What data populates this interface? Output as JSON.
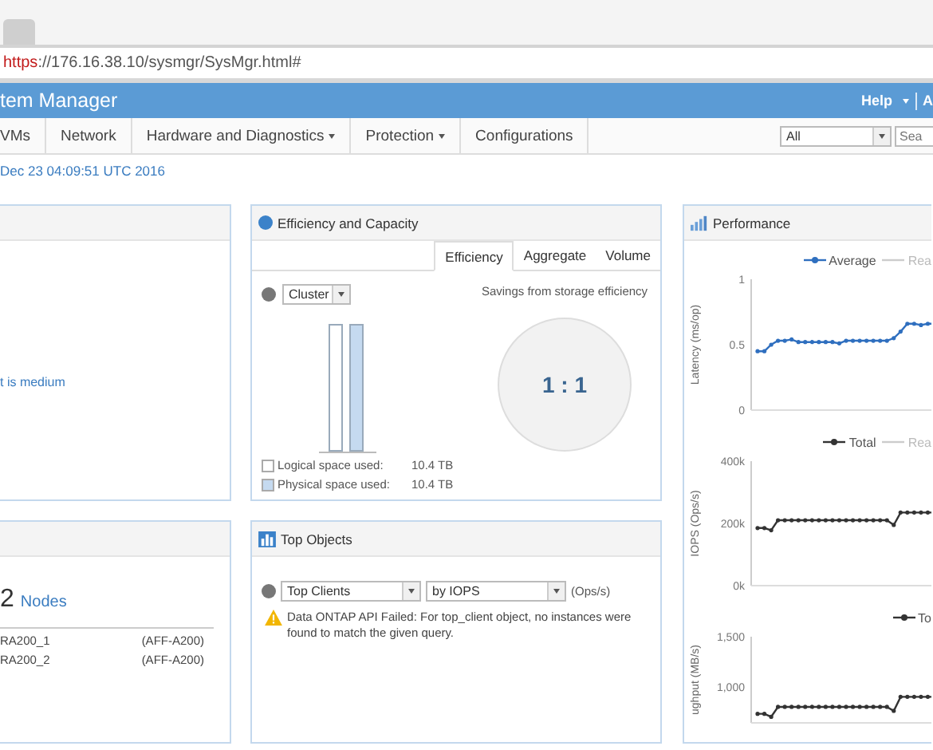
{
  "address_bar": {
    "scheme": "https",
    "rest": "://176.16.38.10/sysmgr/SysMgr.html#"
  },
  "header": {
    "title": "tem Manager",
    "menus": [
      {
        "label": "Help",
        "has_menu": true
      },
      {
        "label": "A",
        "has_menu": false
      }
    ]
  },
  "nav": {
    "items": [
      {
        "label": "VMs",
        "has_menu": false
      },
      {
        "label": "Network",
        "has_menu": false
      },
      {
        "label": "Hardware and Diagnostics",
        "has_menu": true
      },
      {
        "label": "Protection",
        "has_menu": true
      },
      {
        "label": "Configurations",
        "has_menu": false
      }
    ],
    "scope_select": {
      "value": "All"
    },
    "search": {
      "placeholder": "Sea"
    }
  },
  "last_updated": "Dec 23 04:09:51 UTC 2016",
  "health_panel": {
    "message": "t is medium"
  },
  "nodes_panel": {
    "count": "2",
    "label": "Nodes",
    "rows": [
      {
        "name": "RA200_1",
        "model": "(AFF-A200)"
      },
      {
        "name": "RA200_2",
        "model": "(AFF-A200)"
      }
    ]
  },
  "efficiency_panel": {
    "title": "Efficiency and Capacity",
    "tabs": [
      {
        "label": "Efficiency",
        "selected": true
      },
      {
        "label": "Aggregate",
        "selected": false
      },
      {
        "label": "Volume",
        "selected": false
      }
    ],
    "scope_select": {
      "value": "Cluster"
    },
    "legend": [
      {
        "label": "Logical space used:",
        "value": "10.4 TB",
        "color": "#ffffff",
        "level": 1
      },
      {
        "label": "Physical space used:",
        "value": "10.4 TB",
        "color": "#c5daf0",
        "level": 1
      }
    ],
    "savings_caption": "Savings from storage efficiency",
    "ratio": "1 : 1"
  },
  "top_objects_panel": {
    "title": "Top Objects",
    "object_select": {
      "value": "Top Clients"
    },
    "metric_select": {
      "value": "by IOPS"
    },
    "unit": "(Ops/s)",
    "warning": "Data ONTAP API Failed: For top_client object, no instances were found to match the given query."
  },
  "performance_panel": {
    "title": "Performance",
    "charts": [
      {
        "extra_legend": "Rea",
        "chart_data": {
          "type": "line",
          "ylabel": "Latency (ms/op)",
          "ylim": [
            0,
            1
          ],
          "yticks": [
            {
              "value": 1,
              "label": "1"
            },
            {
              "value": 0.5,
              "label": "0.5"
            },
            {
              "value": 0,
              "label": "0"
            }
          ],
          "series": [
            {
              "name": "Average",
              "color": "#2f6fbf",
              "values": [
                0.45,
                0.45,
                0.5,
                0.53,
                0.53,
                0.54,
                0.52,
                0.52,
                0.52,
                0.52,
                0.52,
                0.52,
                0.51,
                0.53,
                0.53,
                0.53,
                0.53,
                0.53,
                0.53,
                0.53,
                0.55,
                0.6,
                0.66,
                0.66,
                0.65,
                0.66,
                0.66
              ]
            }
          ]
        }
      },
      {
        "extra_legend": "Rea",
        "chart_data": {
          "type": "line",
          "ylabel": "IOPS (Ops/s)",
          "ylim": [
            0,
            400000
          ],
          "yticks": [
            {
              "value": 400000,
              "label": "400k"
            },
            {
              "value": 200000,
              "label": "200k"
            },
            {
              "value": 0,
              "label": "0k"
            }
          ],
          "series": [
            {
              "name": "Total",
              "color": "#333333",
              "values": [
                185000,
                185000,
                178000,
                210000,
                210000,
                210000,
                210000,
                210000,
                210000,
                210000,
                210000,
                210000,
                210000,
                210000,
                210000,
                210000,
                210000,
                210000,
                210000,
                210000,
                195000,
                235000,
                235000,
                235000,
                235000,
                235000,
                235000
              ]
            }
          ]
        }
      },
      {
        "chart_data": {
          "type": "line",
          "ylabel": "ughput (MB/s)",
          "ylim": [
            640,
            1500
          ],
          "yticks": [
            {
              "value": 1500,
              "label": "1,500"
            },
            {
              "value": 1000,
              "label": "1,000"
            }
          ],
          "series": [
            {
              "name": "To",
              "color": "#333333",
              "values": [
                730,
                730,
                700,
                800,
                800,
                800,
                800,
                800,
                800,
                800,
                800,
                800,
                800,
                800,
                800,
                800,
                800,
                800,
                800,
                800,
                760,
                900,
                900,
                900,
                900,
                900,
                900
              ]
            }
          ]
        }
      }
    ]
  }
}
